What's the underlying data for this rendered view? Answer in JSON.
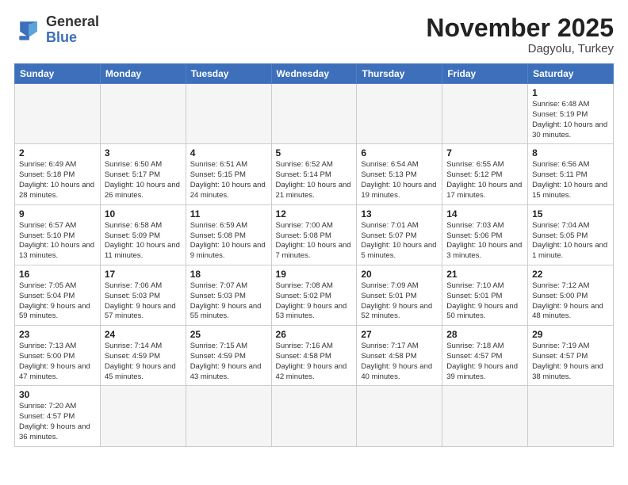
{
  "logo": {
    "line1": "General",
    "line2": "Blue"
  },
  "title": "November 2025",
  "subtitle": "Dagyolu, Turkey",
  "days_of_week": [
    "Sunday",
    "Monday",
    "Tuesday",
    "Wednesday",
    "Thursday",
    "Friday",
    "Saturday"
  ],
  "weeks": [
    [
      {
        "day": "",
        "info": ""
      },
      {
        "day": "",
        "info": ""
      },
      {
        "day": "",
        "info": ""
      },
      {
        "day": "",
        "info": ""
      },
      {
        "day": "",
        "info": ""
      },
      {
        "day": "",
        "info": ""
      },
      {
        "day": "1",
        "info": "Sunrise: 6:48 AM\nSunset: 5:19 PM\nDaylight: 10 hours and 30 minutes."
      }
    ],
    [
      {
        "day": "2",
        "info": "Sunrise: 6:49 AM\nSunset: 5:18 PM\nDaylight: 10 hours and 28 minutes."
      },
      {
        "day": "3",
        "info": "Sunrise: 6:50 AM\nSunset: 5:17 PM\nDaylight: 10 hours and 26 minutes."
      },
      {
        "day": "4",
        "info": "Sunrise: 6:51 AM\nSunset: 5:15 PM\nDaylight: 10 hours and 24 minutes."
      },
      {
        "day": "5",
        "info": "Sunrise: 6:52 AM\nSunset: 5:14 PM\nDaylight: 10 hours and 21 minutes."
      },
      {
        "day": "6",
        "info": "Sunrise: 6:54 AM\nSunset: 5:13 PM\nDaylight: 10 hours and 19 minutes."
      },
      {
        "day": "7",
        "info": "Sunrise: 6:55 AM\nSunset: 5:12 PM\nDaylight: 10 hours and 17 minutes."
      },
      {
        "day": "8",
        "info": "Sunrise: 6:56 AM\nSunset: 5:11 PM\nDaylight: 10 hours and 15 minutes."
      }
    ],
    [
      {
        "day": "9",
        "info": "Sunrise: 6:57 AM\nSunset: 5:10 PM\nDaylight: 10 hours and 13 minutes."
      },
      {
        "day": "10",
        "info": "Sunrise: 6:58 AM\nSunset: 5:09 PM\nDaylight: 10 hours and 11 minutes."
      },
      {
        "day": "11",
        "info": "Sunrise: 6:59 AM\nSunset: 5:08 PM\nDaylight: 10 hours and 9 minutes."
      },
      {
        "day": "12",
        "info": "Sunrise: 7:00 AM\nSunset: 5:08 PM\nDaylight: 10 hours and 7 minutes."
      },
      {
        "day": "13",
        "info": "Sunrise: 7:01 AM\nSunset: 5:07 PM\nDaylight: 10 hours and 5 minutes."
      },
      {
        "day": "14",
        "info": "Sunrise: 7:03 AM\nSunset: 5:06 PM\nDaylight: 10 hours and 3 minutes."
      },
      {
        "day": "15",
        "info": "Sunrise: 7:04 AM\nSunset: 5:05 PM\nDaylight: 10 hours and 1 minute."
      }
    ],
    [
      {
        "day": "16",
        "info": "Sunrise: 7:05 AM\nSunset: 5:04 PM\nDaylight: 9 hours and 59 minutes."
      },
      {
        "day": "17",
        "info": "Sunrise: 7:06 AM\nSunset: 5:03 PM\nDaylight: 9 hours and 57 minutes."
      },
      {
        "day": "18",
        "info": "Sunrise: 7:07 AM\nSunset: 5:03 PM\nDaylight: 9 hours and 55 minutes."
      },
      {
        "day": "19",
        "info": "Sunrise: 7:08 AM\nSunset: 5:02 PM\nDaylight: 9 hours and 53 minutes."
      },
      {
        "day": "20",
        "info": "Sunrise: 7:09 AM\nSunset: 5:01 PM\nDaylight: 9 hours and 52 minutes."
      },
      {
        "day": "21",
        "info": "Sunrise: 7:10 AM\nSunset: 5:01 PM\nDaylight: 9 hours and 50 minutes."
      },
      {
        "day": "22",
        "info": "Sunrise: 7:12 AM\nSunset: 5:00 PM\nDaylight: 9 hours and 48 minutes."
      }
    ],
    [
      {
        "day": "23",
        "info": "Sunrise: 7:13 AM\nSunset: 5:00 PM\nDaylight: 9 hours and 47 minutes."
      },
      {
        "day": "24",
        "info": "Sunrise: 7:14 AM\nSunset: 4:59 PM\nDaylight: 9 hours and 45 minutes."
      },
      {
        "day": "25",
        "info": "Sunrise: 7:15 AM\nSunset: 4:59 PM\nDaylight: 9 hours and 43 minutes."
      },
      {
        "day": "26",
        "info": "Sunrise: 7:16 AM\nSunset: 4:58 PM\nDaylight: 9 hours and 42 minutes."
      },
      {
        "day": "27",
        "info": "Sunrise: 7:17 AM\nSunset: 4:58 PM\nDaylight: 9 hours and 40 minutes."
      },
      {
        "day": "28",
        "info": "Sunrise: 7:18 AM\nSunset: 4:57 PM\nDaylight: 9 hours and 39 minutes."
      },
      {
        "day": "29",
        "info": "Sunrise: 7:19 AM\nSunset: 4:57 PM\nDaylight: 9 hours and 38 minutes."
      }
    ],
    [
      {
        "day": "30",
        "info": "Sunrise: 7:20 AM\nSunset: 4:57 PM\nDaylight: 9 hours and 36 minutes."
      },
      {
        "day": "",
        "info": ""
      },
      {
        "day": "",
        "info": ""
      },
      {
        "day": "",
        "info": ""
      },
      {
        "day": "",
        "info": ""
      },
      {
        "day": "",
        "info": ""
      },
      {
        "day": "",
        "info": ""
      }
    ]
  ]
}
